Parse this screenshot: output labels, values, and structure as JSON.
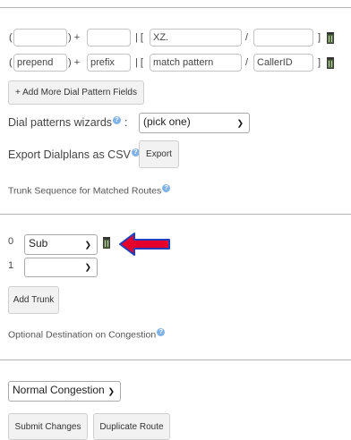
{
  "dial_patterns": {
    "row1": {
      "open_paren": "(",
      "prepend_value": "",
      "close_plus": ") +",
      "prefix_value": "",
      "pipe_bracket": "| [",
      "match_value": "XZ.",
      "slash": "/",
      "callerid_value": "",
      "close_bracket": "]"
    },
    "row2": {
      "open_paren": "(",
      "prepend_placeholder": "prepend",
      "close_plus": ") +",
      "prefix_placeholder": "prefix",
      "pipe_bracket": "| [",
      "match_placeholder": "match pattern",
      "slash": "/",
      "callerid_placeholder": "CallerID",
      "close_bracket": "]"
    },
    "add_more_label": "+ Add More Dial Pattern Fields",
    "wizards_label": "Dial patterns wizards",
    "wizards_colon": ":",
    "wizards_selected": "(pick one)",
    "export_label": "Export Dialplans as CSV",
    "export_colon": ":",
    "export_button": "Export"
  },
  "trunk_sequence": {
    "heading": "Trunk Sequence for Matched Routes",
    "rows": [
      {
        "index": "0",
        "selected": "Sub"
      },
      {
        "index": "1",
        "selected": ""
      }
    ],
    "add_trunk_label": "Add Trunk"
  },
  "congestion": {
    "heading": "Optional Destination on Congestion",
    "selected": "Normal Congestion"
  },
  "footer": {
    "submit_label": "Submit Changes",
    "duplicate_label": "Duplicate Route"
  },
  "colors": {
    "arrow_fill": "#e4002b",
    "arrow_outline": "#1f3fbf",
    "help_icon": "#7fb3e8"
  },
  "icons": {
    "trash": "trash-icon",
    "help": "help-icon",
    "arrow": "red-arrow-icon"
  }
}
